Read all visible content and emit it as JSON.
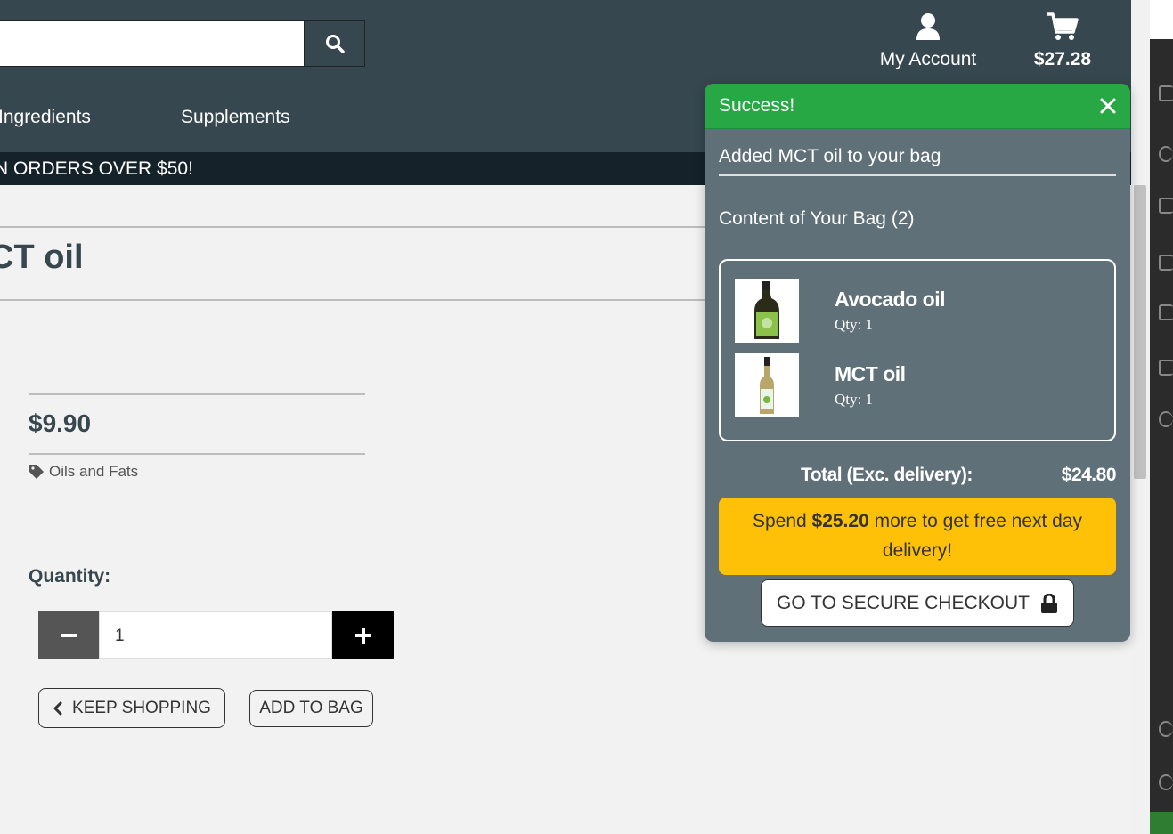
{
  "header": {
    "search": {
      "value": "",
      "placeholder": ""
    },
    "account_label": "My Account",
    "cart_total": "$27.28",
    "nav": [
      "Ingredients",
      "Supplements"
    ],
    "banner": "N ORDERS OVER $50!"
  },
  "product": {
    "title": "CT oil",
    "price": "$9.90",
    "category": "Oils and Fats",
    "quantity_label": "Quantity:",
    "quantity_value": "1",
    "keep_shopping": "KEEP SHOPPING",
    "add_to_bag": "ADD TO BAG"
  },
  "toast": {
    "title": "Success!",
    "message": "Added MCT oil to your bag",
    "bag_title": "Content of Your Bag (2)",
    "items": [
      {
        "name": "Avocado oil",
        "qty": "Qty: 1"
      },
      {
        "name": "MCT oil",
        "qty": "Qty: 1"
      }
    ],
    "total_label": "Total (Exc. delivery):",
    "total_value": "$24.80",
    "free_delivery": {
      "prefix": "Spend ",
      "amount": "$25.20",
      "suffix": " more to get free next day delivery!"
    },
    "checkout": "GO TO SECURE CHECKOUT"
  },
  "colors": {
    "header_bg": "#37474f",
    "banner_bg": "#15222a",
    "success_green": "#28a745",
    "toast_bg": "#607078",
    "warning_yellow": "#ffc107"
  }
}
